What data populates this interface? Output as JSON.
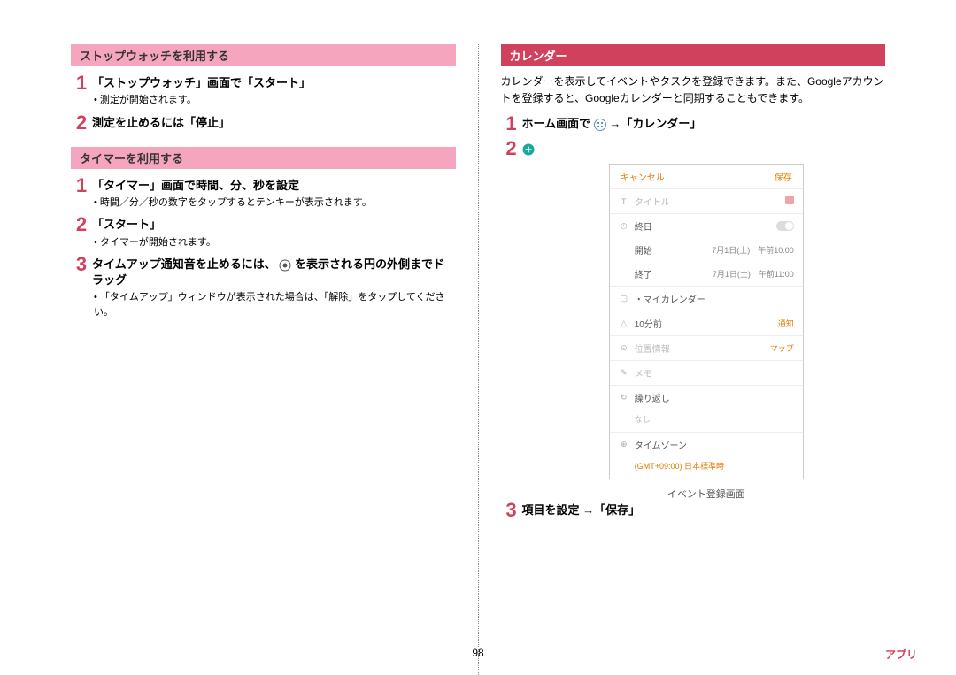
{
  "page_number": "98",
  "footer_category": "アプリ",
  "left": {
    "section1": {
      "header": "ストップウォッチを利用する",
      "steps": [
        {
          "num": "1",
          "title": "「ストップウォッチ」画面で「スタート」",
          "note": "測定が開始されます。"
        },
        {
          "num": "2",
          "title": "測定を止めるには「停止」"
        }
      ]
    },
    "section2": {
      "header": "タイマーを利用する",
      "steps": [
        {
          "num": "1",
          "title": "「タイマー」画面で時間、分、秒を設定",
          "note": "時間／分／秒の数字をタップするとテンキーが表示されます。"
        },
        {
          "num": "2",
          "title": "「スタート」",
          "note": "タイマーが開始されます。"
        },
        {
          "num": "3",
          "title_a": "タイムアップ通知音を止めるには、",
          "title_b": " を表示される円の外側までドラッグ",
          "note": "「タイムアップ」ウィンドウが表示された場合は、「解除」をタップしてください。"
        }
      ]
    }
  },
  "right": {
    "header": "カレンダー",
    "intro": "カレンダーを表示してイベントやタスクを登録できます。また、Googleアカウントを登録すると、Googleカレンダーと同期することもできます。",
    "steps": [
      {
        "num": "1",
        "title_a": "ホーム画面で ",
        "title_b": " →「カレンダー」"
      },
      {
        "num": "2",
        "title": ""
      },
      {
        "num": "3",
        "title": "項目を設定 →「保存」"
      }
    ],
    "mock": {
      "cancel": "キャンセル",
      "save": "保存",
      "title_placeholder": "タイトル",
      "allday": "終日",
      "start_label": "開始",
      "start_val": "7月1日(土)　午前10:00",
      "end_label": "終了",
      "end_val": "7月1日(土)　午前11:00",
      "calendar": "・マイカレンダー",
      "reminder": "10分前",
      "reminder_action": "通知",
      "location": "位置情報",
      "location_action": "マップ",
      "memo": "メモ",
      "repeat": "繰り返し",
      "repeat_val": "なし",
      "timezone": "タイムゾーン",
      "timezone_val": "(GMT+09:00) 日本標準時",
      "caption": "イベント登録画面"
    }
  }
}
